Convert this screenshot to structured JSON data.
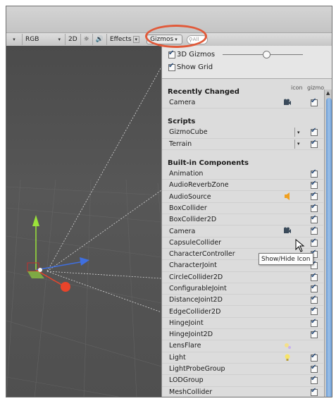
{
  "toolbar": {
    "shading_mode": "RGB",
    "mode_2d": "2D",
    "effects_label": "Effects",
    "gizmos_label": "Gizmos",
    "search_prefix": "All"
  },
  "gizmos_panel": {
    "gizmos_3d_label": "3D Gizmos",
    "show_grid_label": "Show Grid",
    "col_icon": "icon",
    "col_gizmo": "gizmo",
    "recently_changed_title": "Recently Changed",
    "recently_changed": [
      {
        "label": "Camera",
        "icon": "camera-icon",
        "checked": true
      }
    ],
    "scripts_title": "Scripts",
    "scripts": [
      {
        "label": "GizmoCube",
        "dropdown": true,
        "checked": true
      },
      {
        "label": "Terrain",
        "dropdown": true,
        "checked": true
      }
    ],
    "builtin_title": "Built-in Components",
    "builtin": [
      {
        "label": "Animation",
        "icon": "",
        "checked": true
      },
      {
        "label": "AudioReverbZone",
        "icon": "",
        "checked": true
      },
      {
        "label": "AudioSource",
        "icon": "speaker-icon",
        "checked": true
      },
      {
        "label": "BoxCollider",
        "icon": "",
        "checked": true
      },
      {
        "label": "BoxCollider2D",
        "icon": "",
        "checked": true
      },
      {
        "label": "Camera",
        "icon": "camera-icon",
        "checked": true
      },
      {
        "label": "CapsuleCollider",
        "icon": "",
        "checked": true
      },
      {
        "label": "CharacterController",
        "icon": "",
        "checked": true
      },
      {
        "label": "CharacterJoint",
        "icon": "",
        "checked": true
      },
      {
        "label": "CircleCollider2D",
        "icon": "",
        "checked": true
      },
      {
        "label": "ConfigurableJoint",
        "icon": "",
        "checked": true
      },
      {
        "label": "DistanceJoint2D",
        "icon": "",
        "checked": true
      },
      {
        "label": "EdgeCollider2D",
        "icon": "",
        "checked": true
      },
      {
        "label": "HingeJoint",
        "icon": "",
        "checked": true
      },
      {
        "label": "HingeJoint2D",
        "icon": "",
        "checked": true
      },
      {
        "label": "LensFlare",
        "icon": "lensflare-icon",
        "checked": false
      },
      {
        "label": "Light",
        "icon": "lightbulb-icon",
        "checked": true
      },
      {
        "label": "LightProbeGroup",
        "icon": "",
        "checked": true
      },
      {
        "label": "LODGroup",
        "icon": "",
        "checked": true
      },
      {
        "label": "MeshCollider",
        "icon": "",
        "checked": true
      }
    ],
    "icon_size_level": 0.62
  },
  "tooltip": "Show/Hide Icon",
  "colors": {
    "callout": "#e15a3a",
    "scene_bg": "#525252",
    "scrollbar": "#7aa8dc",
    "axis_y": "#9be33a",
    "axis_x": "#e8442a",
    "axis_z": "#3f6fe0"
  }
}
